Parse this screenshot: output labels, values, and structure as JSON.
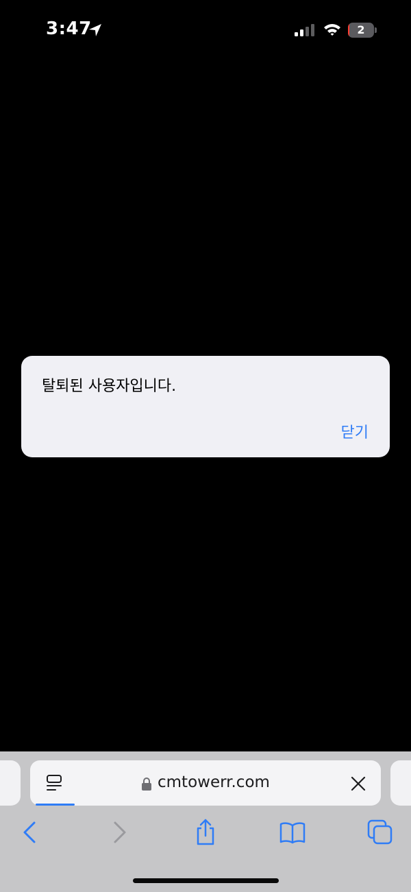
{
  "status_bar": {
    "time": "3:47",
    "battery_level": "2",
    "battery_fraction": 0.05,
    "signal_bars_active": 2,
    "signal_bars_total": 4
  },
  "alert": {
    "message": "탈퇴된 사용자입니다.",
    "close_label": "닫기"
  },
  "browser": {
    "url": "cmtowerr.com",
    "secure": true
  },
  "toolbar": {
    "back_icon": "chevron-left-icon",
    "forward_icon": "chevron-right-icon",
    "share_icon": "share-icon",
    "bookmarks_icon": "book-icon",
    "tabs_icon": "tabs-icon"
  },
  "colors": {
    "accent": "#2f7cf6",
    "alert_background": "#f0f0f5",
    "toolbar_background": "#c6c6c8",
    "battery_low": "#ff3b30"
  }
}
